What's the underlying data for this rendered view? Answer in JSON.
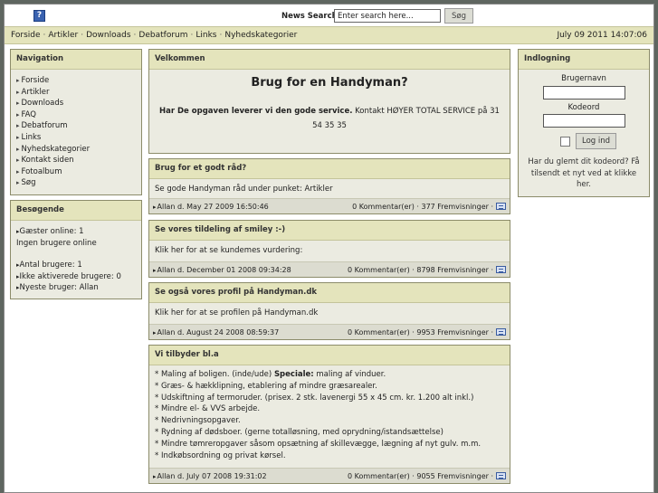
{
  "topbar": {
    "help_icon": "?",
    "search_label": "News Search:",
    "search_value": "Enter search here...",
    "search_button": "Søg"
  },
  "nav": {
    "links": [
      "Forside",
      "Artikler",
      "Downloads",
      "Debatforum",
      "Links",
      "Nyhedskategorier"
    ],
    "datetime": "July 09 2011 14:07:06"
  },
  "sidebar": {
    "navigation": {
      "title": "Navigation",
      "items": [
        "Forside",
        "Artikler",
        "Downloads",
        "FAQ",
        "Debatforum",
        "Links",
        "Nyhedskategorier",
        "Kontakt siden",
        "Fotoalbum",
        "Søg"
      ]
    },
    "visitors": {
      "title": "Besøgende",
      "guests": "Gæster online: 1",
      "users_online": "Ingen brugere online",
      "member_count": "Antal brugere: 1",
      "inactive": "Ikke aktiverede brugere: 0",
      "newest": "Nyeste bruger: Allan"
    }
  },
  "welcome": {
    "header": "Velkommen",
    "title": "Brug for en Handyman?",
    "text_bold": "Har De opgaven leverer vi den gode service.",
    "text_rest": " Kontakt HØYER TOTAL SERVICE på 31 54 35 35"
  },
  "articles": [
    {
      "title": "Brug for et godt råd?",
      "body": "Se gode Handyman råd under punket: Artikler",
      "meta_left": "Allan d. May 27 2009 16:50:46",
      "meta_right": "0 Kommentar(er) · 377 Fremvisninger ·"
    },
    {
      "title": "Se vores tildeling af smiley :-)",
      "body": "Klik her for at se kundemes vurdering:",
      "meta_left": "Allan d. December 01 2008 09:34:28",
      "meta_right": "0 Kommentar(er) · 8798 Fremvisninger ·"
    },
    {
      "title": "Se også vores profil på Handyman.dk",
      "body": "Klik her for at se profilen på Handyman.dk",
      "meta_left": "Allan d. August 24 2008 08:59:37",
      "meta_right": "0 Kommentar(er) · 9953 Fremvisninger ·"
    }
  ],
  "offers": {
    "title": "Vi tilbyder bl.a",
    "items": [
      {
        "prefix": "* Maling af boligen. (inde/ude) ",
        "bold": "Speciale:",
        "suffix": " maling af vinduer."
      },
      {
        "prefix": "* Græs- & hækklipning, etablering af mindre græsarealer.",
        "bold": "",
        "suffix": ""
      },
      {
        "prefix": "* Udskiftning af termoruder. (prisex. 2 stk. lavenergi 55 x 45 cm. kr. 1.200 alt inkl.)",
        "bold": "",
        "suffix": ""
      },
      {
        "prefix": "* Mindre el- & VVS arbejde.",
        "bold": "",
        "suffix": ""
      },
      {
        "prefix": "* Nedrivningsopgaver.",
        "bold": "",
        "suffix": ""
      },
      {
        "prefix": "* Rydning af dødsboer. (gerne totalløsning, med oprydning/istandsættelse)",
        "bold": "",
        "suffix": ""
      },
      {
        "prefix": "* Mindre tømreropgaver såsom opsætning af skillevægge, lægning af nyt gulv. m.m.",
        "bold": "",
        "suffix": ""
      },
      {
        "prefix": "* Indkøbsordning og privat kørsel.",
        "bold": "",
        "suffix": ""
      }
    ],
    "meta_left": "Allan d. July 07 2008 19:31:02",
    "meta_right": "0 Kommentar(er) · 9055 Fremvisninger ·"
  },
  "login": {
    "title": "Indlogning",
    "username_label": "Brugernavn",
    "password_label": "Kodeord",
    "button": "Log ind",
    "forgot": "Har du glemt dit kodeord? Få tilsendt et nyt ved at klikke her."
  },
  "colors": {
    "background": "#5f6660",
    "panel_header": "#e4e4bc",
    "panel_body": "#ebebe1",
    "meta_bar": "#dcdcd0"
  },
  "icons": {
    "help": "help-icon",
    "print": "printer-icon",
    "bullet": "triangle-right-icon"
  }
}
